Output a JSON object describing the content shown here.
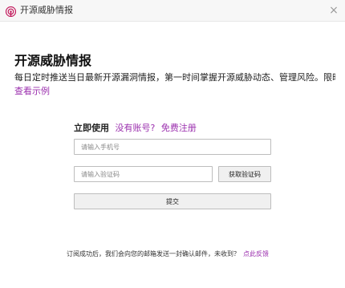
{
  "window": {
    "title": "开源威胁情报",
    "close_glyph": "×"
  },
  "intro": {
    "heading": "开源威胁情报",
    "description": "每日定时推送当日最新开源漏洞情报，第一时间掌握开源威胁动态、管理风险。限时免费",
    "example_link": "查看示例"
  },
  "form": {
    "title": "立即使用",
    "no_account": "没有账号?",
    "register_link": "免费注册",
    "phone_placeholder": "请输入手机号",
    "code_placeholder": "请输入验证码",
    "get_code_label": "获取验证码",
    "submit_label": "提交"
  },
  "footer": {
    "text": "订阅成功后，我们会向您的邮箱发送一封确认邮件，未收到？",
    "feedback_link": "点此反馈"
  },
  "colors": {
    "accent": "#9b2fae",
    "icon": "#c2185b"
  },
  "icons": {
    "app": "broadcast-signal-icon",
    "close": "close-icon"
  }
}
